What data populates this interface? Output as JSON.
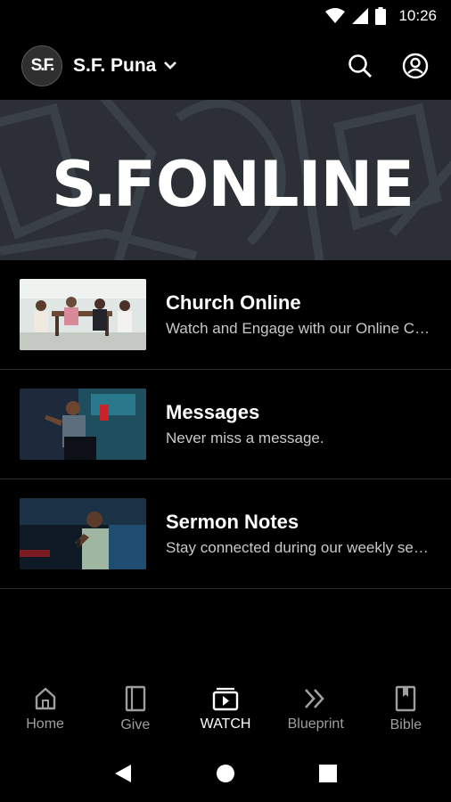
{
  "status_bar": {
    "time": "10:26"
  },
  "header": {
    "avatar_text": "S.F.",
    "campus_name": "S.F. Puna",
    "icons": [
      "chevron-down-icon",
      "search-icon",
      "account-icon"
    ]
  },
  "banner": {
    "logo_text": "S.F",
    "word": "ONLINE"
  },
  "list": [
    {
      "title": "Church Online",
      "subtitle": "Watch and Engage with our Online Church"
    },
    {
      "title": "Messages",
      "subtitle": "Never miss a message."
    },
    {
      "title": "Sermon Notes",
      "subtitle": "Stay connected during our weekly services"
    }
  ],
  "tabs": [
    {
      "label": "Home",
      "icon": "home-icon",
      "active": false
    },
    {
      "label": "Give",
      "icon": "give-icon",
      "active": false
    },
    {
      "label": "WATCH",
      "icon": "watch-icon",
      "active": true
    },
    {
      "label": "Blueprint",
      "icon": "blueprint-icon",
      "active": false
    },
    {
      "label": "Bible",
      "icon": "bible-icon",
      "active": false
    }
  ],
  "colors": {
    "background": "#000000",
    "banner": "#2c3036",
    "inactive_tab": "#9e9e9e",
    "active_tab": "#ffffff"
  }
}
